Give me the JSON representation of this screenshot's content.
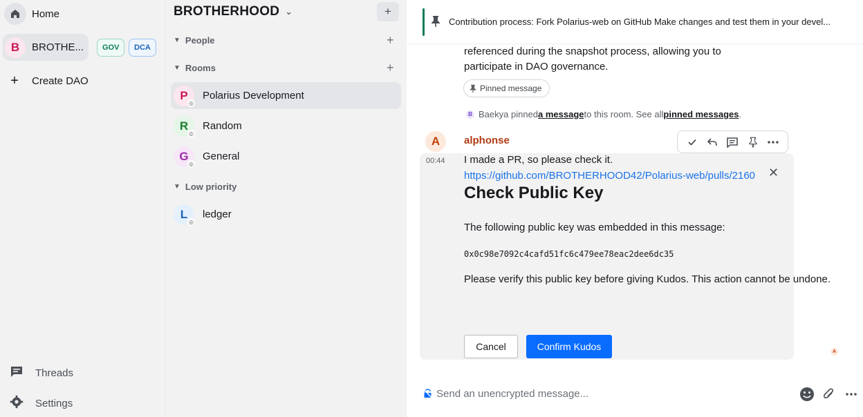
{
  "rail": {
    "home_label": "Home",
    "dao": {
      "avatar_letter": "B",
      "label": "BROTHE...",
      "chips": [
        "GOV",
        "DCA"
      ]
    },
    "create_label": "Create DAO",
    "threads_label": "Threads",
    "settings_label": "Settings"
  },
  "room_list": {
    "space_title": "BROTHERHOOD",
    "add_symbol": "+",
    "sections": {
      "people": "People",
      "rooms": "Rooms",
      "low_priority": "Low priority"
    },
    "rooms": [
      {
        "letter": "P",
        "name": "Polarius Development",
        "color": "#c9175b",
        "bg": "#fde6ee",
        "active": true
      },
      {
        "letter": "R",
        "name": "Random",
        "color": "#1a7f2e",
        "bg": "#e4f6e6",
        "active": false
      },
      {
        "letter": "G",
        "name": "General",
        "color": "#9b2aa8",
        "bg": "#f6e6f8",
        "active": false
      }
    ],
    "low_priority_rooms": [
      {
        "letter": "L",
        "name": "ledger",
        "color": "#1d63b8",
        "bg": "#e4f0fb",
        "active": false
      }
    ]
  },
  "pinned_banner": {
    "text": "Contribution process: Fork Polarius-web on GitHub Make changes and test them in your devel..."
  },
  "timeline": {
    "prev_line1": "referenced during the snapshot process, allowing you to",
    "prev_line2": "participate in DAO governance.",
    "pinned_pill": "Pinned message",
    "notice": {
      "avatar_letter": "B",
      "pre": "Baekya pinned ",
      "link1": "a message",
      "mid": " to this room. See all ",
      "link2": "pinned messages",
      "post": "."
    },
    "message": {
      "avatar_letter": "A",
      "sender": "alphonse",
      "time": "00:44",
      "text": "I made a PR, so please check it.",
      "link": "https://github.com/BROTHERHOOD42/Polarius-web/pulls/2160"
    },
    "kudos": {
      "title": "Check Public Key",
      "desc": "The following public key was embedded in this message:",
      "pubkey": "0x0c98e7092c4cafd51fc6c479ee78eac2dee6dc35",
      "verify": "Please verify this public key before giving Kudos. This action cannot be undone.",
      "cancel": "Cancel",
      "confirm": "Confirm Kudos"
    },
    "read_receipt": "A"
  },
  "composer": {
    "placeholder": "Send an unencrypted message..."
  },
  "colors": {
    "accent": "#0a6cff",
    "pin_bar": "#0f7a5c",
    "sender": "#b23b12"
  }
}
